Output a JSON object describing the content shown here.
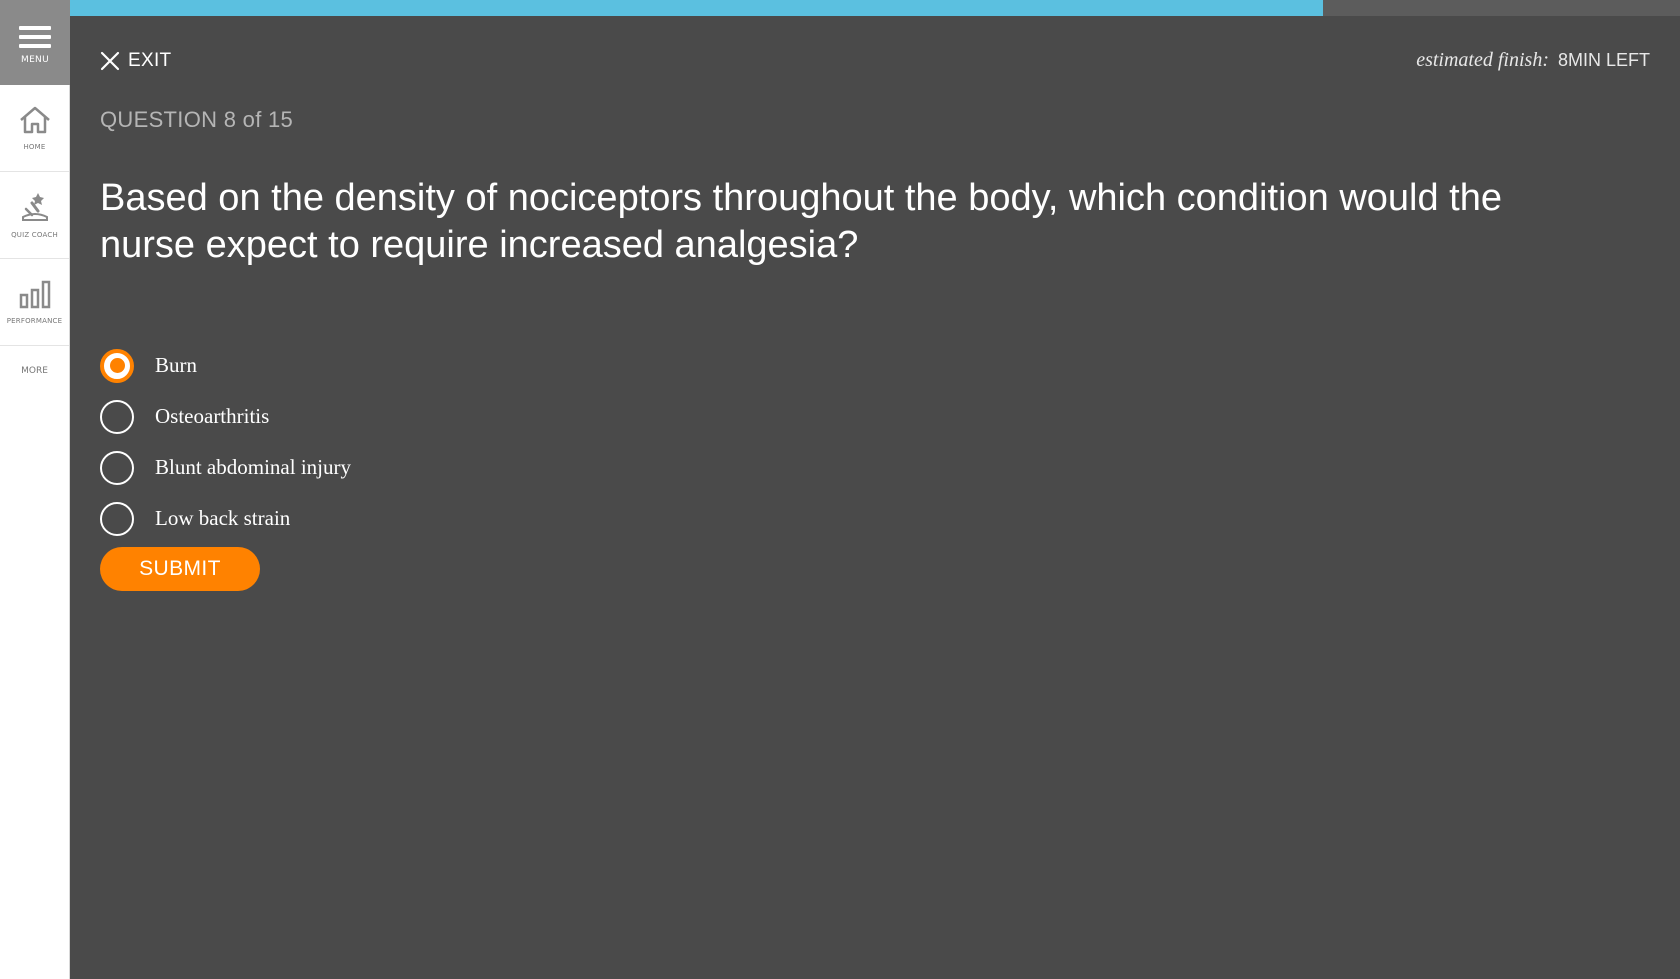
{
  "sidebar": {
    "menu_label": "MENU",
    "items": [
      {
        "label": "HOME",
        "icon": "home-icon"
      },
      {
        "label": "QUIZ COACH",
        "icon": "quiz-coach-icon"
      },
      {
        "label": "PERFORMANCE",
        "icon": "bar-chart-icon"
      }
    ],
    "more_label": "MORE"
  },
  "progress": {
    "fraction": 0.778,
    "fill_color": "#5bc0e0"
  },
  "header": {
    "exit_label": "EXIT",
    "estimate_prefix": "estimated finish:",
    "estimate_time": "8MIN LEFT"
  },
  "question": {
    "counter": "QUESTION 8 of 15",
    "text": "Based on the density of nociceptors throughout the body, which condition would the nurse expect to require increased analgesia?",
    "options": [
      {
        "label": "Burn",
        "selected": true
      },
      {
        "label": "Osteoarthritis",
        "selected": false
      },
      {
        "label": "Blunt abdominal injury",
        "selected": false
      },
      {
        "label": "Low back strain",
        "selected": false
      }
    ]
  },
  "submit_label": "SUBMIT",
  "colors": {
    "accent": "#ff8200",
    "background": "#4a4a4a",
    "progress": "#5bc0e0"
  }
}
